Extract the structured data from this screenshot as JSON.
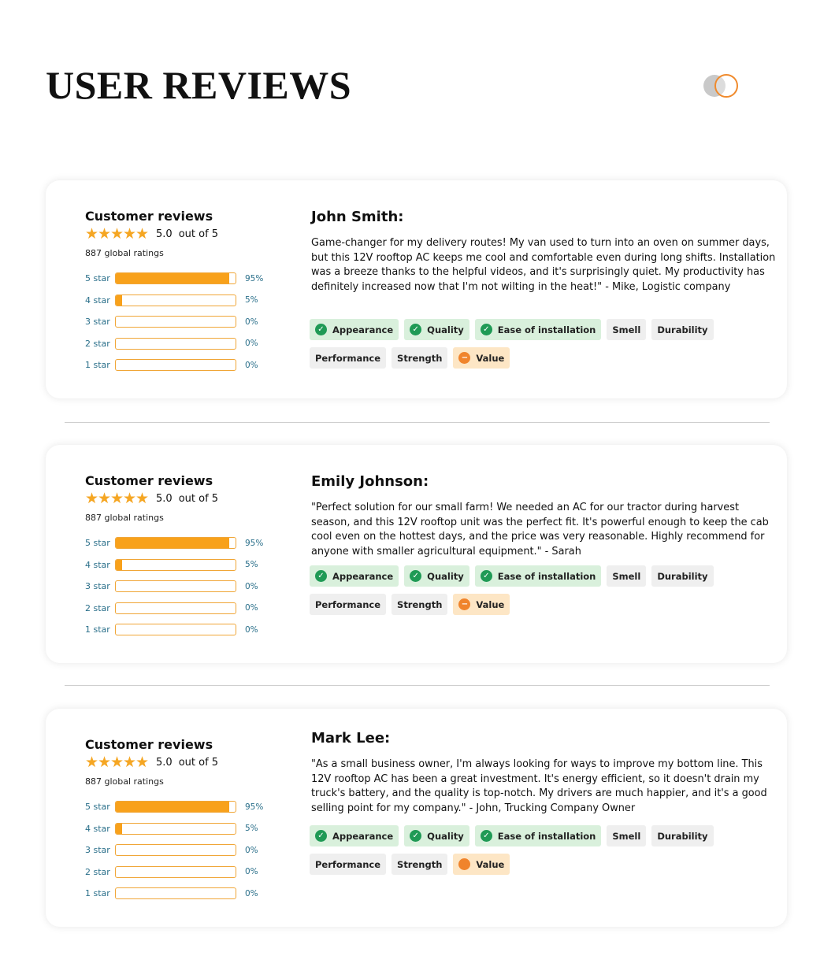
{
  "title": "USER REVIEWS",
  "colors": {
    "star": "#f5a623",
    "bar_fill": "#f8a11b",
    "positive": "#1f9a55",
    "negative": "#f0842c"
  },
  "reviews": [
    {
      "summary": {
        "title": "Customer reviews",
        "rating": "5.0",
        "out_of": "out of 5",
        "global": "887 global ratings",
        "bars": [
          {
            "label": "5 star",
            "pct": "95%",
            "value": 95
          },
          {
            "label": "4 star",
            "pct": "5%",
            "value": 5
          },
          {
            "label": "3 star",
            "pct": "0%",
            "value": 0
          },
          {
            "label": "2 star",
            "pct": "0%",
            "value": 0
          },
          {
            "label": "1 star",
            "pct": "0%",
            "value": 0
          }
        ]
      },
      "name": "John Smith:",
      "text": "Game-changer for my delivery routes! My van used to turn into an oven on summer days, but this 12V rooftop AC keeps me cool and comfortable even during long shifts. Installation was a breeze thanks to the helpful videos, and it's surprisingly quiet. My productivity has definitely increased now that I'm not wilting in the heat!\" - Mike, Logistic company",
      "tags": [
        {
          "label": "Appearance",
          "status": "pos"
        },
        {
          "label": "Quality",
          "status": "pos"
        },
        {
          "label": "Ease of installation",
          "status": "pos"
        },
        {
          "label": "Smell",
          "status": "none"
        },
        {
          "label": "Durability",
          "status": "none"
        },
        {
          "label": "Performance",
          "status": "none"
        },
        {
          "label": "Strength",
          "status": "none"
        },
        {
          "label": "Value",
          "status": "neg"
        }
      ]
    },
    {
      "summary": {
        "title": "Customer reviews",
        "rating": "5.0",
        "out_of": "out of 5",
        "global": "887 global ratings",
        "bars": [
          {
            "label": "5 star",
            "pct": "95%",
            "value": 95
          },
          {
            "label": "4 star",
            "pct": "5%",
            "value": 5
          },
          {
            "label": "3 star",
            "pct": "0%",
            "value": 0
          },
          {
            "label": "2 star",
            "pct": "0%",
            "value": 0
          },
          {
            "label": "1 star",
            "pct": "0%",
            "value": 0
          }
        ]
      },
      "name": "Emily Johnson:",
      "text": "\"Perfect solution for our small farm! We needed an AC for our tractor during harvest season, and this 12V rooftop unit was the perfect fit. It's powerful enough to keep the cab cool even on the hottest days, and the price was very reasonable. Highly recommend for anyone with smaller agricultural equipment.\" - Sarah",
      "tags": [
        {
          "label": "Appearance",
          "status": "pos"
        },
        {
          "label": "Quality",
          "status": "pos"
        },
        {
          "label": "Ease of installation",
          "status": "pos"
        },
        {
          "label": "Smell",
          "status": "none"
        },
        {
          "label": "Durability",
          "status": "none"
        },
        {
          "label": "Performance",
          "status": "none"
        },
        {
          "label": "Strength",
          "status": "none"
        },
        {
          "label": "Value",
          "status": "neg"
        }
      ]
    },
    {
      "summary": {
        "title": "Customer reviews",
        "rating": "5.0",
        "out_of": "out of 5",
        "global": "887 global ratings",
        "bars": [
          {
            "label": "5 star",
            "pct": "95%",
            "value": 95
          },
          {
            "label": "4 star",
            "pct": "5%",
            "value": 5
          },
          {
            "label": "3 star",
            "pct": "0%",
            "value": 0
          },
          {
            "label": "2 star",
            "pct": "0%",
            "value": 0
          },
          {
            "label": "1 star",
            "pct": "0%",
            "value": 0
          }
        ]
      },
      "name": "Mark Lee:",
      "text": "\"As a small business owner, I'm always looking for ways to improve my bottom line. This 12V rooftop AC has been a great investment. It's energy efficient, so it doesn't drain my truck's battery, and the quality is top-notch. My drivers are much happier, and it's a good selling point for my company.\" - John, Trucking Company Owner",
      "tags": [
        {
          "label": "Appearance",
          "status": "pos"
        },
        {
          "label": "Quality",
          "status": "pos"
        },
        {
          "label": "Ease of installation",
          "status": "pos"
        },
        {
          "label": "Smell",
          "status": "none"
        },
        {
          "label": "Durability",
          "status": "none"
        },
        {
          "label": "Performance",
          "status": "none"
        },
        {
          "label": "Strength",
          "status": "none"
        },
        {
          "label": "Value",
          "status": "neg-dot"
        }
      ]
    }
  ]
}
